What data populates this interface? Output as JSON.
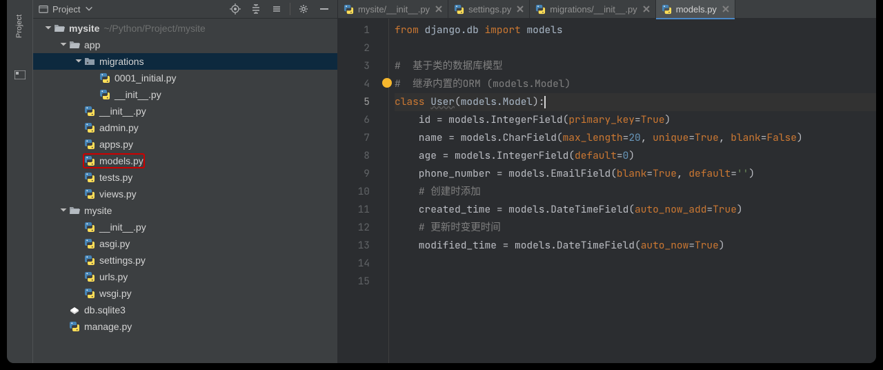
{
  "sidebar": {
    "title_label": "Project",
    "rail_hint": "Project"
  },
  "toolbar": {
    "locate": "locate",
    "expand_all": "expand_all",
    "collapse_all": "collapse_all",
    "settings": "settings",
    "hide": "hide"
  },
  "tree": {
    "root": {
      "name": "mysite",
      "path": "~/Python/Project/mysite"
    },
    "items": [
      {
        "depth": 0,
        "kind": "dir-root",
        "label": "mysite",
        "path": "~/Python/Project/mysite",
        "expanded": true
      },
      {
        "depth": 1,
        "kind": "dir",
        "label": "app",
        "expanded": true
      },
      {
        "depth": 2,
        "kind": "pkg",
        "label": "migrations",
        "expanded": true,
        "selected": true
      },
      {
        "depth": 3,
        "kind": "py",
        "label": "0001_initial.py"
      },
      {
        "depth": 3,
        "kind": "py",
        "label": "__init__.py"
      },
      {
        "depth": 2,
        "kind": "py",
        "label": "__init__.py"
      },
      {
        "depth": 2,
        "kind": "py",
        "label": "admin.py"
      },
      {
        "depth": 2,
        "kind": "py",
        "label": "apps.py"
      },
      {
        "depth": 2,
        "kind": "py",
        "label": "models.py",
        "highlighted": true
      },
      {
        "depth": 2,
        "kind": "py",
        "label": "tests.py"
      },
      {
        "depth": 2,
        "kind": "py",
        "label": "views.py"
      },
      {
        "depth": 1,
        "kind": "dir",
        "label": "mysite",
        "expanded": true
      },
      {
        "depth": 2,
        "kind": "py",
        "label": "__init__.py"
      },
      {
        "depth": 2,
        "kind": "py",
        "label": "asgi.py"
      },
      {
        "depth": 2,
        "kind": "py",
        "label": "settings.py"
      },
      {
        "depth": 2,
        "kind": "py",
        "label": "urls.py"
      },
      {
        "depth": 2,
        "kind": "py",
        "label": "wsgi.py"
      },
      {
        "depth": 1,
        "kind": "db",
        "label": "db.sqlite3"
      },
      {
        "depth": 1,
        "kind": "py",
        "label": "manage.py"
      }
    ]
  },
  "tabs": [
    {
      "label": "mysite/__init__.py",
      "icon": "py",
      "active": false
    },
    {
      "label": "settings.py",
      "icon": "py",
      "active": false
    },
    {
      "label": "migrations/__init__.py",
      "icon": "py",
      "active": false
    },
    {
      "label": "models.py",
      "icon": "py",
      "active": true
    }
  ],
  "code": {
    "lines": [
      {
        "n": 1,
        "html": "<span class='kw'>from</span> <span class='ident'>django.db</span> <span class='kw'>import</span> <span class='ident'>models</span>"
      },
      {
        "n": 2,
        "html": ""
      },
      {
        "n": 3,
        "html": "<span class='comment'>#  基于类的数据库模型</span>"
      },
      {
        "n": 4,
        "html": "<span class='comment'>#  继承内置的ORM (models.Model)</span>",
        "bulb": true
      },
      {
        "n": 5,
        "html": "<span class='kw'>class</span> <span class='ident' style='text-decoration:underline wavy rgba(128,128,128,.5)'>User</span>(<span class='ident'>models.Model</span>):",
        "current": true,
        "cursor": true
      },
      {
        "n": 6,
        "html": "    id = models.IntegerField(<span class='param'>primary_key</span>=<span class='kw'>True</span>)"
      },
      {
        "n": 7,
        "html": "    name = models.CharField(<span class='param'>max_length</span>=<span class='num'>20</span>, <span class='param'>unique</span>=<span class='kw'>True</span>, <span class='param'>blank</span>=<span class='kw'>False</span>)"
      },
      {
        "n": 8,
        "html": "    age = models.IntegerField(<span class='param'>default</span>=<span class='num'>0</span>)"
      },
      {
        "n": 9,
        "html": "    phone_number = models.EmailField(<span class='param'>blank</span>=<span class='kw'>True</span>, <span class='param'>default</span>=<span class='str'>''</span>)"
      },
      {
        "n": 10,
        "html": "    <span class='comment'># 创建时添加</span>"
      },
      {
        "n": 11,
        "html": "    created_time = models.DateTimeField(<span class='param'>auto_now_add</span>=<span class='kw'>True</span>)"
      },
      {
        "n": 12,
        "html": "    <span class='comment'># 更新时变更时间</span>"
      },
      {
        "n": 13,
        "html": "    modified_time = models.DateTimeField(<span class='param'>auto_now</span>=<span class='kw'>True</span>)"
      },
      {
        "n": 14,
        "html": ""
      },
      {
        "n": 15,
        "html": ""
      }
    ]
  },
  "colors": {
    "accent": "#4a88c7",
    "highlight_box": "#cc0000",
    "bg_panel": "#3c3f41",
    "bg_editor": "#2b2d30"
  }
}
